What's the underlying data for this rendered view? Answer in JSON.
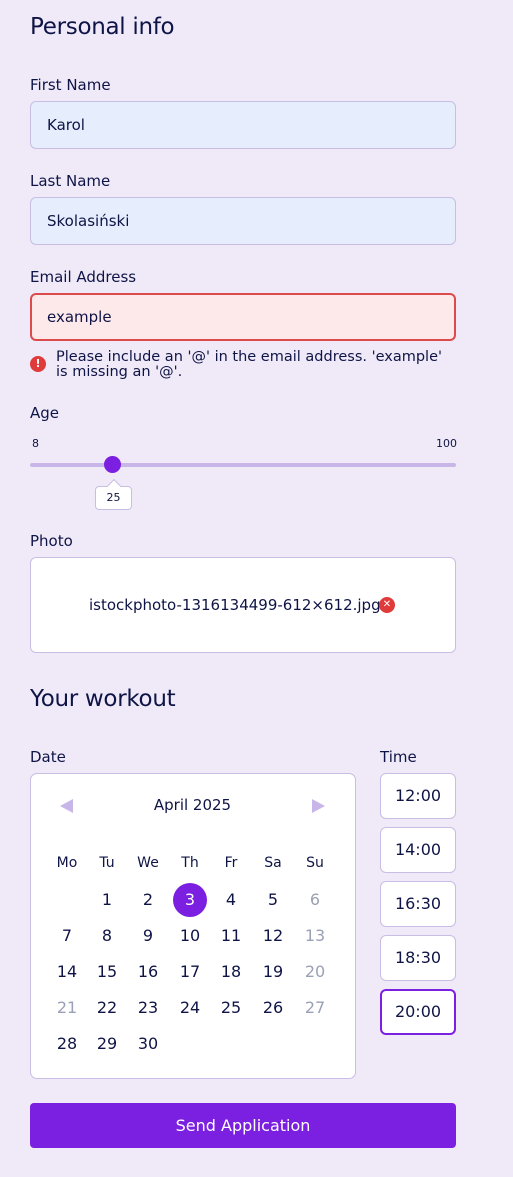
{
  "personal": {
    "title": "Personal info",
    "first_name": {
      "label": "First Name",
      "value": "Karol"
    },
    "last_name": {
      "label": "Last Name",
      "value": "Skolasiński"
    },
    "email": {
      "label": "Email Address",
      "value": "example",
      "error_line1": "Please include an '@' in the email address. 'example'",
      "error_line2": "is missing an '@'."
    },
    "age": {
      "label": "Age",
      "min": "8",
      "max": "100",
      "value": "25"
    },
    "photo": {
      "label": "Photo",
      "file_name": "istockphoto-1316134499-612×612.jpg"
    }
  },
  "workout": {
    "title": "Your workout",
    "date_label": "Date",
    "time_label": "Time",
    "calendar": {
      "month": "April 2025",
      "weekdays": [
        "Mo",
        "Tu",
        "We",
        "Th",
        "Fr",
        "Sa",
        "Su"
      ],
      "weeks": [
        [
          "",
          "1",
          "2",
          "3",
          "4",
          "5",
          "6"
        ],
        [
          "7",
          "8",
          "9",
          "10",
          "11",
          "12",
          "13"
        ],
        [
          "14",
          "15",
          "16",
          "17",
          "18",
          "19",
          "20"
        ],
        [
          "21",
          "22",
          "23",
          "24",
          "25",
          "26",
          "27"
        ],
        [
          "28",
          "29",
          "30",
          "",
          "",
          "",
          ""
        ]
      ],
      "selected": "3",
      "muted": [
        "6",
        "13",
        "20",
        "21",
        "27"
      ]
    },
    "times": [
      "12:00",
      "14:00",
      "16:30",
      "18:30",
      "20:00"
    ],
    "selected_time": "20:00"
  },
  "submit_label": "Send Application",
  "colors": {
    "accent": "#7B1FE0",
    "error": "#E03B3B",
    "background": "#F0EAF8"
  }
}
